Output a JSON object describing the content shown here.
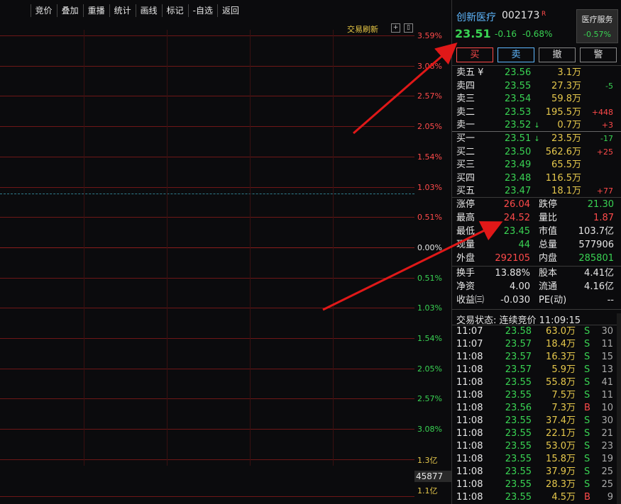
{
  "toolbar": [
    "竞价",
    "叠加",
    "重播",
    "统计",
    "画线",
    "标记",
    "-自选",
    "返回"
  ],
  "refresh_label": "交易刷新",
  "chart_pct_labels": [
    {
      "text": "3.59%",
      "color": "red"
    },
    {
      "text": "3.08%",
      "color": "red"
    },
    {
      "text": "2.57%",
      "color": "red"
    },
    {
      "text": "2.05%",
      "color": "red"
    },
    {
      "text": "1.54%",
      "color": "red"
    },
    {
      "text": "1.03%",
      "color": "red"
    },
    {
      "text": "0.51%",
      "color": "red"
    },
    {
      "text": "0.00%",
      "color": "white"
    },
    {
      "text": "0.51%",
      "color": "green"
    },
    {
      "text": "1.03%",
      "color": "green"
    },
    {
      "text": "1.54%",
      "color": "green"
    },
    {
      "text": "2.05%",
      "color": "green"
    },
    {
      "text": "2.57%",
      "color": "green"
    },
    {
      "text": "3.08%",
      "color": "green"
    }
  ],
  "volume": {
    "top": "1.3亿",
    "bottom": "1.1亿",
    "current": "45877"
  },
  "stock": {
    "name": "创新医疗",
    "code": "002173",
    "badge": "R",
    "price": "23.51",
    "change": "-0.16",
    "change_pct": "-0.68%"
  },
  "sector": {
    "name": "医疗服务",
    "change": "-0.57%"
  },
  "actions": [
    "买",
    "卖",
    "撤",
    "警"
  ],
  "asks": [
    {
      "label": "卖五 ¥",
      "price": "23.56",
      "vol": "3.1万",
      "delta": ""
    },
    {
      "label": "卖四",
      "price": "23.55",
      "vol": "27.3万",
      "delta": "-5"
    },
    {
      "label": "卖三",
      "price": "23.54",
      "vol": "59.8万",
      "delta": ""
    },
    {
      "label": "卖二",
      "price": "23.53",
      "vol": "195.5万",
      "delta": "+448"
    },
    {
      "label": "卖一",
      "price": "23.52",
      "vol": "0.7万",
      "delta": "+3",
      "arrow": "↓"
    }
  ],
  "bids": [
    {
      "label": "买一",
      "price": "23.51",
      "vol": "23.5万",
      "delta": "-17",
      "arrow": "↓"
    },
    {
      "label": "买二",
      "price": "23.50",
      "vol": "562.6万",
      "delta": "+25"
    },
    {
      "label": "买三",
      "price": "23.49",
      "vol": "65.5万",
      "delta": ""
    },
    {
      "label": "买四",
      "price": "23.48",
      "vol": "116.5万",
      "delta": ""
    },
    {
      "label": "买五",
      "price": "23.47",
      "vol": "18.1万",
      "delta": "+77"
    }
  ],
  "stats1": [
    {
      "l1": "涨停",
      "v1": "26.04",
      "c1": "red",
      "l2": "跌停",
      "v2": "21.30",
      "c2": "green"
    },
    {
      "l1": "最高",
      "v1": "24.52",
      "c1": "red",
      "l2": "量比",
      "v2": "1.87",
      "c2": "red"
    },
    {
      "l1": "最低",
      "v1": "23.45",
      "c1": "green",
      "l2": "市值",
      "v2": "103.7亿",
      "c2": "white"
    },
    {
      "l1": "现量",
      "v1": "44",
      "c1": "green",
      "l2": "总量",
      "v2": "577906",
      "c2": "white"
    },
    {
      "l1": "外盘",
      "v1": "292105",
      "c1": "red",
      "l2": "内盘",
      "v2": "285801",
      "c2": "green"
    }
  ],
  "stats2": [
    {
      "l1": "换手",
      "v1": "13.88%",
      "l2": "股本",
      "v2": "4.41亿"
    },
    {
      "l1": "净资",
      "v1": "4.00",
      "l2": "流通",
      "v2": "4.16亿"
    },
    {
      "l1": "收益㈢",
      "v1": "-0.030",
      "l2": "PE(动)",
      "v2": "--"
    }
  ],
  "trade_status": "交易状态: 连续竞价 11:09:15",
  "ticks": [
    {
      "time": "11:07",
      "price": "23.58",
      "vol": "63.0万",
      "bs": "S",
      "n": "30"
    },
    {
      "time": "11:07",
      "price": "23.57",
      "vol": "18.4万",
      "bs": "S",
      "n": "11"
    },
    {
      "time": "11:08",
      "price": "23.57",
      "vol": "16.3万",
      "bs": "S",
      "n": "15"
    },
    {
      "time": "11:08",
      "price": "23.57",
      "vol": "5.9万",
      "bs": "S",
      "n": "13"
    },
    {
      "time": "11:08",
      "price": "23.55",
      "vol": "55.8万",
      "bs": "S",
      "n": "41"
    },
    {
      "time": "11:08",
      "price": "23.55",
      "vol": "7.5万",
      "bs": "S",
      "n": "11"
    },
    {
      "time": "11:08",
      "price": "23.56",
      "vol": "7.3万",
      "bs": "B",
      "n": "10"
    },
    {
      "time": "11:08",
      "price": "23.55",
      "vol": "37.4万",
      "bs": "S",
      "n": "30"
    },
    {
      "time": "11:08",
      "price": "23.55",
      "vol": "22.1万",
      "bs": "S",
      "n": "21"
    },
    {
      "time": "11:08",
      "price": "23.55",
      "vol": "53.0万",
      "bs": "S",
      "n": "23"
    },
    {
      "time": "11:08",
      "price": "23.55",
      "vol": "15.8万",
      "bs": "S",
      "n": "19"
    },
    {
      "time": "11:08",
      "price": "23.55",
      "vol": "37.9万",
      "bs": "S",
      "n": "25"
    },
    {
      "time": "11:08",
      "price": "23.55",
      "vol": "28.3万",
      "bs": "S",
      "n": "25"
    },
    {
      "time": "11:08",
      "price": "23.55",
      "vol": "4.5万",
      "bs": "B",
      "n": "9"
    }
  ]
}
